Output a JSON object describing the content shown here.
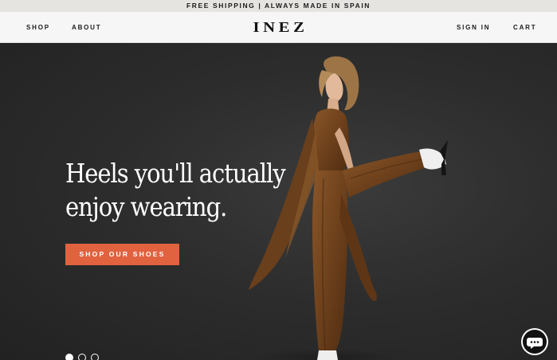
{
  "announcement": {
    "text": "FREE SHIPPING | ALWAYS MADE IN SPAIN"
  },
  "nav": {
    "left": [
      {
        "label": "SHOP"
      },
      {
        "label": "ABOUT"
      }
    ],
    "logo": "INEZ",
    "right": [
      {
        "label": "SIGN IN"
      },
      {
        "label": "CART"
      }
    ]
  },
  "hero": {
    "heading_line1": "Heels you'll actually",
    "heading_line2": "enjoy wearing.",
    "cta_label": "SHOP OUR SHOES",
    "slides": {
      "count": 3,
      "active": 1
    }
  },
  "colors": {
    "accent": "#e1623f",
    "hero_bg": "#2d2d2d",
    "announcement_bg": "#e6e4e1",
    "nav_bg": "#f6f6f6",
    "outfit": "#7a4a22"
  },
  "icons": {
    "chat": "chat-bubble-icon"
  }
}
